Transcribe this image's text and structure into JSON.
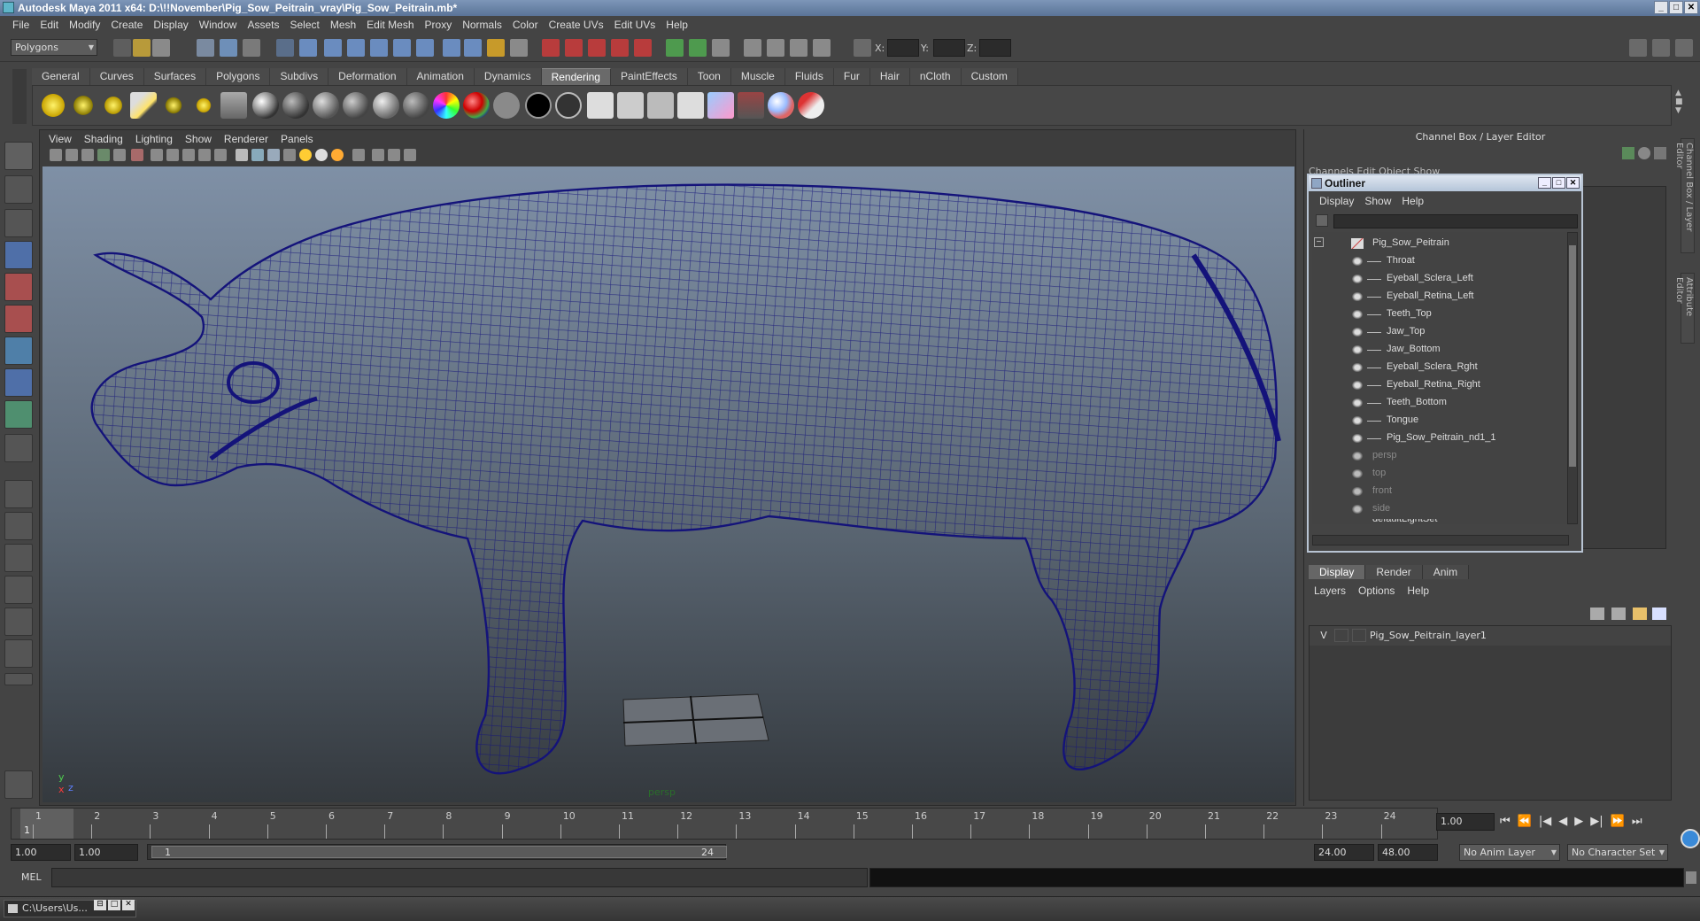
{
  "app": {
    "title": "Autodesk Maya 2011 x64: D:\\!!November\\Pig_Sow_Peitrain_vray\\Pig_Sow_Peitrain.mb*",
    "window_buttons": [
      "_",
      "□",
      "✕"
    ]
  },
  "menubar": [
    "File",
    "Edit",
    "Modify",
    "Create",
    "Display",
    "Window",
    "Assets",
    "Select",
    "Mesh",
    "Edit Mesh",
    "Proxy",
    "Normals",
    "Color",
    "Create UVs",
    "Edit UVs",
    "Help"
  ],
  "statusline": {
    "mode": "Polygons",
    "x_label": "X:",
    "y_label": "Y:",
    "z_label": "Z:"
  },
  "shelf": {
    "tabs": [
      "General",
      "Curves",
      "Surfaces",
      "Polygons",
      "Subdivs",
      "Deformation",
      "Animation",
      "Dynamics",
      "Rendering",
      "PaintEffects",
      "Toon",
      "Muscle",
      "Fluids",
      "Fur",
      "Hair",
      "nCloth",
      "Custom"
    ],
    "active_tab": "Rendering"
  },
  "viewport": {
    "menu": [
      "View",
      "Shading",
      "Lighting",
      "Show",
      "Renderer",
      "Panels"
    ],
    "camera_label": "persp",
    "axis": {
      "y": "y",
      "x": "x",
      "z": "z"
    },
    "wire_color": "#14137a"
  },
  "channel_box": {
    "title": "Channel Box / Layer Editor",
    "menu_partial": "Channels   Edit   Object   Show",
    "side_tabs": [
      "Channel Box / Layer Editor",
      "Attribute Editor"
    ]
  },
  "outliner": {
    "title": "Outliner",
    "menu": [
      "Display",
      "Show",
      "Help"
    ],
    "root": "Pig_Sow_Peitrain",
    "children": [
      "Throat",
      "Eyeball_Sclera_Left",
      "Eyeball_Retina_Left",
      "Teeth_Top",
      "Jaw_Top",
      "Jaw_Bottom",
      "Eyeball_Sclera_Rght",
      "Eyeball_Retina_Right",
      "Teeth_Bottom",
      "Tongue",
      "Pig_Sow_Peitrain_nd1_1"
    ],
    "cameras": [
      "persp",
      "top",
      "front",
      "side"
    ],
    "sets": [
      "defaultLightSet"
    ],
    "expand_symbol": "−"
  },
  "layer_editor": {
    "tabs": [
      "Display",
      "Render",
      "Anim"
    ],
    "active_tab": "Display",
    "menu": [
      "Layers",
      "Options",
      "Help"
    ],
    "layers": [
      {
        "visible": "V",
        "name": "Pig_Sow_Peitrain_layer1"
      }
    ]
  },
  "timeline": {
    "ticks": [
      "1",
      "2",
      "3",
      "4",
      "5",
      "6",
      "7",
      "8",
      "9",
      "10",
      "11",
      "12",
      "13",
      "14",
      "15",
      "16",
      "17",
      "18",
      "19",
      "20",
      "21",
      "22",
      "23",
      "24"
    ],
    "current_marker": "1",
    "current_frame": "1.00",
    "controls": [
      "⏮",
      "⏪",
      "|◀",
      "◀",
      "▶",
      "▶|",
      "⏩",
      "⏭"
    ]
  },
  "range": {
    "start": "1.00",
    "playback_start": "1.00",
    "slider_start": "1",
    "slider_end": "24",
    "playback_end": "24.00",
    "end": "48.00",
    "anim_layer": "No Anim Layer",
    "char_set": "No Character Set"
  },
  "command_line": {
    "label": "MEL"
  },
  "taskbar": {
    "item": "C:\\Users\\Us...",
    "buttons": [
      "⊟",
      "□",
      "✕"
    ]
  }
}
